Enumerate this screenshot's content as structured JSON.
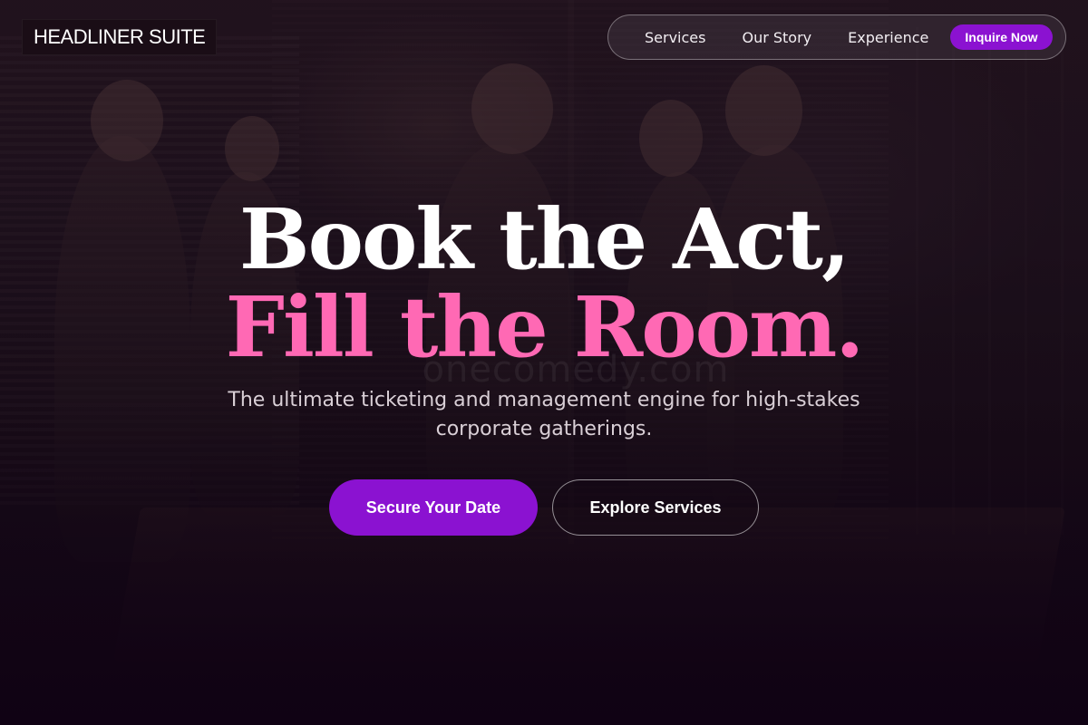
{
  "brand": {
    "name": "HEADLINER SUITE"
  },
  "nav": {
    "links": [
      "Services",
      "Our Story",
      "Experience"
    ],
    "cta_label": "Inquire Now"
  },
  "hero": {
    "title_line1": "Book the Act,",
    "title_line2": "Fill the Room.",
    "subtitle": "The ultimate ticketing and management engine for high-stakes corporate gatherings.",
    "primary_button": "Secure Your Date",
    "secondary_button": "Explore Services",
    "watermark": "onecomedy.com"
  },
  "colors": {
    "accent": "#8b12d1",
    "highlight": "#ff69b4",
    "text": "#ffffff"
  }
}
